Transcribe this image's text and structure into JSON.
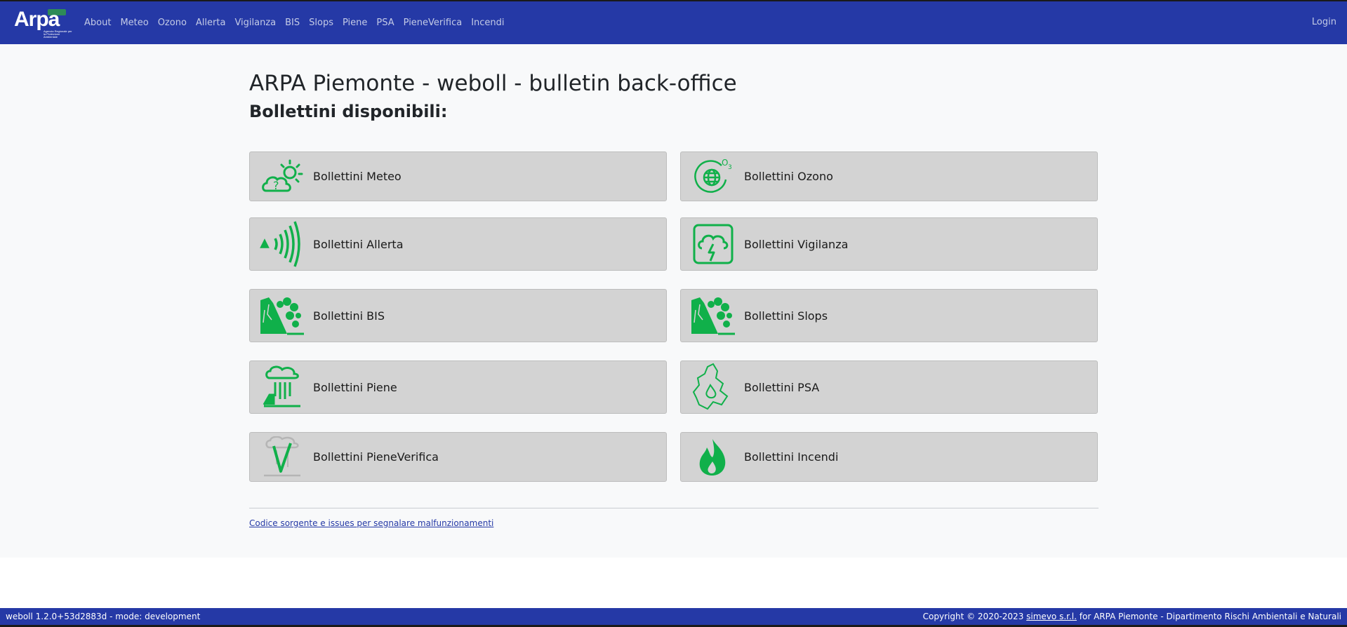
{
  "navbar": {
    "logo_text": "Arpa",
    "logo_sub": "Agenzia Regionale per la Protezione Ambientale",
    "links": [
      "About",
      "Meteo",
      "Ozono",
      "Allerta",
      "Vigilanza",
      "BIS",
      "Slops",
      "Piene",
      "PSA",
      "PieneVerifica",
      "Incendi"
    ],
    "login": "Login"
  },
  "main": {
    "title": "ARPA Piemonte - weboll - bulletin back-office",
    "subtitle": "Bollettini disponibili:",
    "cards": [
      {
        "label": "Bollettini Meteo",
        "icon": "weather-icon"
      },
      {
        "label": "Bollettini Ozono",
        "icon": "ozone-globe-icon"
      },
      {
        "label": "Bollettini Allerta",
        "icon": "alert-signal-icon"
      },
      {
        "label": "Bollettini Vigilanza",
        "icon": "storm-lightning-icon"
      },
      {
        "label": "Bollettini BIS",
        "icon": "landslide-icon"
      },
      {
        "label": "Bollettini Slops",
        "icon": "landslide-icon"
      },
      {
        "label": "Bollettini Piene",
        "icon": "flood-rain-icon"
      },
      {
        "label": "Bollettini PSA",
        "icon": "piemonte-map-drop-icon"
      },
      {
        "label": "Bollettini PieneVerifica",
        "icon": "flood-check-icon"
      },
      {
        "label": "Bollettini Incendi",
        "icon": "fire-icon"
      }
    ],
    "source_link": "Codice sorgente e issues per segnalare malfunzionamenti"
  },
  "footer": {
    "version": "weboll 1.2.0+53d2883d - mode: development",
    "copyright_prefix": "Copyright © 2020-2023",
    "company": "simevo s.r.l.",
    "copyright_suffix": "for ARPA Piemonte - Dipartimento Rischi Ambientali e Naturali"
  },
  "colors": {
    "navbar": "#2539a6",
    "icon_green": "#10b04a",
    "card_bg": "#d3d3d3"
  }
}
